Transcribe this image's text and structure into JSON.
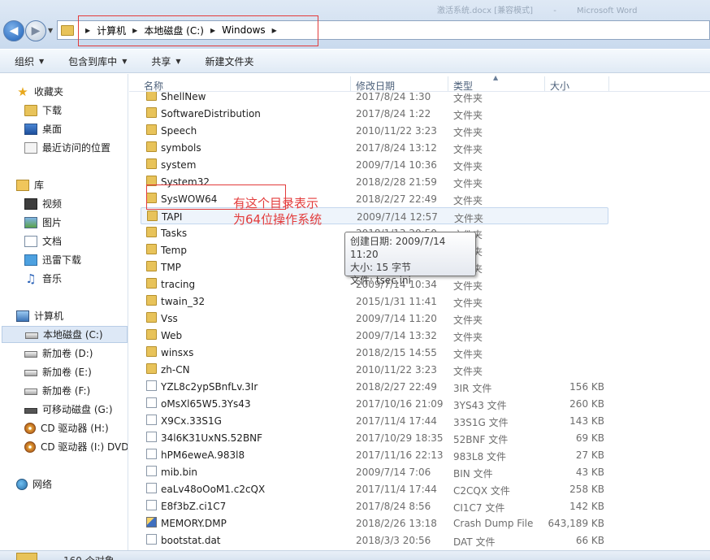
{
  "title_ghost": [
    "激活系统.docx [兼容模式]",
    "-",
    "Microsoft Word"
  ],
  "address": {
    "crumbs": [
      "计算机",
      "本地磁盘 (C:)",
      "Windows"
    ]
  },
  "toolbar": {
    "items": [
      "组织",
      "包含到库中",
      "共享",
      "新建文件夹"
    ]
  },
  "sidebar": {
    "favorites": "收藏夹",
    "fav_items": [
      "下载",
      "桌面",
      "最近访问的位置"
    ],
    "libraries": "库",
    "lib_items": [
      "视频",
      "图片",
      "文档",
      "迅雷下载",
      "音乐"
    ],
    "computer": "计算机",
    "drives": [
      "本地磁盘 (C:)",
      "新加卷 (D:)",
      "新加卷 (E:)",
      "新加卷 (F:)",
      "可移动磁盘 (G:)",
      "CD 驱动器 (H:)",
      "CD 驱动器 (I:) DVD"
    ],
    "network": "网络"
  },
  "columns": {
    "name": "名称",
    "date": "修改日期",
    "type": "类型",
    "size": "大小"
  },
  "files": [
    {
      "name": "ShellNew",
      "date": "2017/8/24 1:30",
      "type": "文件夹",
      "size": "",
      "kind": "folder"
    },
    {
      "name": "SoftwareDistribution",
      "date": "2017/8/24 1:22",
      "type": "文件夹",
      "size": "",
      "kind": "folder"
    },
    {
      "name": "Speech",
      "date": "2010/11/22 3:23",
      "type": "文件夹",
      "size": "",
      "kind": "folder"
    },
    {
      "name": "symbols",
      "date": "2017/8/24 13:12",
      "type": "文件夹",
      "size": "",
      "kind": "folder"
    },
    {
      "name": "system",
      "date": "2009/7/14 10:36",
      "type": "文件夹",
      "size": "",
      "kind": "folder"
    },
    {
      "name": "System32",
      "date": "2018/2/28 21:59",
      "type": "文件夹",
      "size": "",
      "kind": "folder"
    },
    {
      "name": "SysWOW64",
      "date": "2018/2/27 22:49",
      "type": "文件夹",
      "size": "",
      "kind": "folder"
    },
    {
      "name": "TAPI",
      "date": "2009/7/14 12:57",
      "type": "文件夹",
      "size": "",
      "kind": "folder"
    },
    {
      "name": "Tasks",
      "date": "2018/1/13 20:50",
      "type": "文件夹",
      "size": "",
      "kind": "folder"
    },
    {
      "name": "Temp",
      "date": "",
      "type": "文件夹",
      "size": "",
      "kind": "folder"
    },
    {
      "name": "TMP",
      "date": "",
      "type": "文件夹",
      "size": "",
      "kind": "folder"
    },
    {
      "name": "tracing",
      "date": "2009/7/14 10:34",
      "type": "文件夹",
      "size": "",
      "kind": "folder"
    },
    {
      "name": "twain_32",
      "date": "2015/1/31 11:41",
      "type": "文件夹",
      "size": "",
      "kind": "folder"
    },
    {
      "name": "Vss",
      "date": "2009/7/14 11:20",
      "type": "文件夹",
      "size": "",
      "kind": "folder"
    },
    {
      "name": "Web",
      "date": "2009/7/14 13:32",
      "type": "文件夹",
      "size": "",
      "kind": "folder"
    },
    {
      "name": "winsxs",
      "date": "2018/2/15 14:55",
      "type": "文件夹",
      "size": "",
      "kind": "folder"
    },
    {
      "name": "zh-CN",
      "date": "2010/11/22 3:23",
      "type": "文件夹",
      "size": "",
      "kind": "folder"
    },
    {
      "name": "YZL8c2ypSBnfLv.3Ir",
      "date": "2018/2/27 22:49",
      "type": "3IR 文件",
      "size": "156 KB",
      "kind": "file"
    },
    {
      "name": "oMsXl65W5.3Ys43",
      "date": "2017/10/16 21:09",
      "type": "3YS43 文件",
      "size": "260 KB",
      "kind": "file"
    },
    {
      "name": "X9Cx.33S1G",
      "date": "2017/11/4 17:44",
      "type": "33S1G 文件",
      "size": "143 KB",
      "kind": "file"
    },
    {
      "name": "34l6K31UxNS.52BNF",
      "date": "2017/10/29 18:35",
      "type": "52BNF 文件",
      "size": "69 KB",
      "kind": "file"
    },
    {
      "name": "hPM6eweA.983l8",
      "date": "2017/11/16 22:13",
      "type": "983L8 文件",
      "size": "27 KB",
      "kind": "file"
    },
    {
      "name": "mib.bin",
      "date": "2009/7/14 7:06",
      "type": "BIN 文件",
      "size": "43 KB",
      "kind": "file"
    },
    {
      "name": "eaLv48oOoM1.c2cQX",
      "date": "2017/11/4 17:44",
      "type": "C2CQX 文件",
      "size": "258 KB",
      "kind": "file"
    },
    {
      "name": "E8f3bZ.ci1C7",
      "date": "2017/8/24 8:56",
      "type": "CI1C7 文件",
      "size": "142 KB",
      "kind": "file"
    },
    {
      "name": "MEMORY.DMP",
      "date": "2018/2/26 13:18",
      "type": "Crash Dump File",
      "size": "643,189 KB",
      "kind": "dump"
    },
    {
      "name": "bootstat.dat",
      "date": "2018/3/3 20:56",
      "type": "DAT 文件",
      "size": "66 KB",
      "kind": "file"
    }
  ],
  "annotation": {
    "line1": "有这个目录表示",
    "line2": "为64位操作系统",
    "color": "#e33b3b"
  },
  "tooltip": {
    "line1": "创建日期: 2009/7/14 11:20",
    "line2": "大小: 15 字节",
    "line3": "文件: tsec.ini"
  },
  "status": {
    "text": "160 个对象"
  }
}
